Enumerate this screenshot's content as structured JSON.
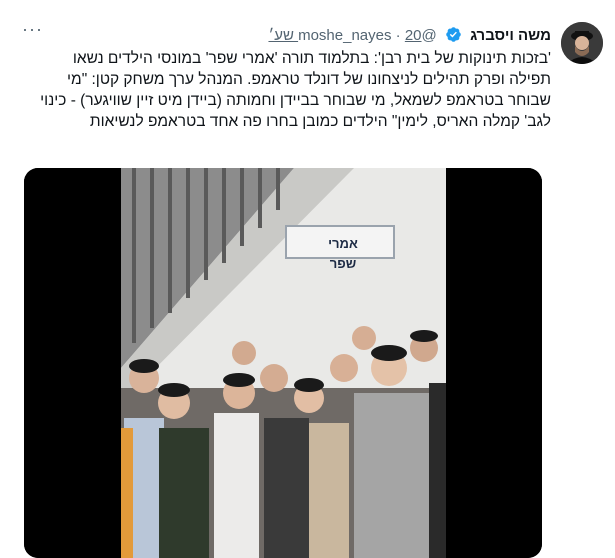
{
  "tweet": {
    "author": {
      "display_name": "משה ויסברג",
      "handle": "@moshe_nayes",
      "verified": true,
      "avatar_icon": "profile-photo"
    },
    "timestamp": "20 שע׳",
    "separator": "·",
    "more_label": "···",
    "text": "'בזכות תינוקות של בית רבן': בתלמוד תורה 'אמרי שפר' במונסי הילדים נשאו תפילה ופרק תהילים לניצחונו של דונלד טראמפ. המנהל ערך משחק קטן: \"מי שבוחר בטראמפ לשמאל, מי שבוחר בביידן וחמותה (ביידן מיט זיין שוויגער) - כינוי לגב' קמלה האריס, לימין\" הילדים כמובן בחרו פה אחד בטראמפ לנשיאות",
    "media": {
      "type": "video",
      "sign_text": "אמרי שפר",
      "icon": "video-thumbnail"
    }
  },
  "colors": {
    "text": "#0f1419",
    "secondary": "#536471",
    "verified": "#1d9bf0",
    "background": "#ffffff"
  }
}
